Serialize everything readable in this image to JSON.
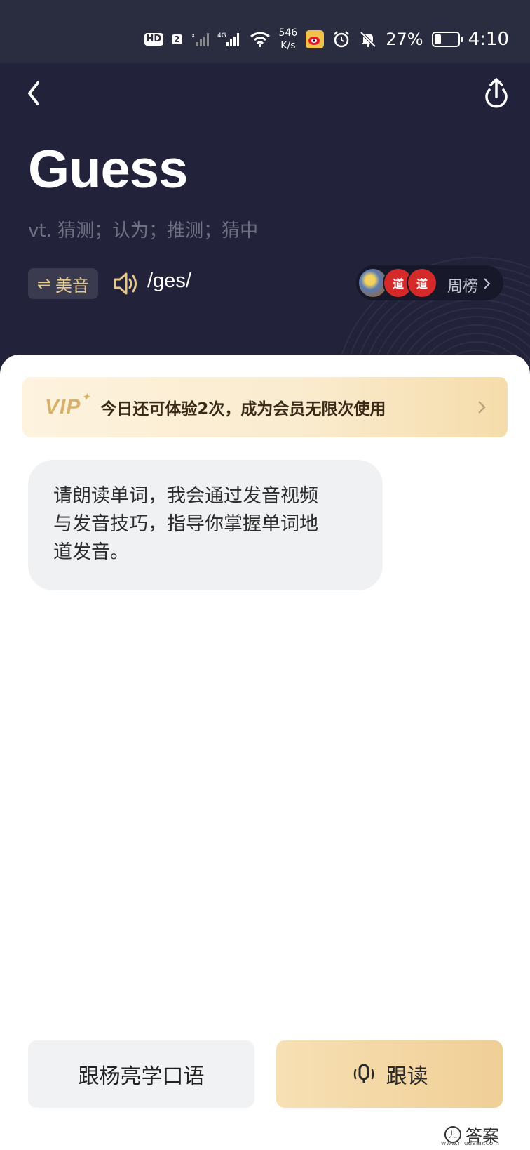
{
  "status_bar": {
    "hd": "HD",
    "sim": "2",
    "network": "4G",
    "speed_value": "546",
    "speed_unit": "K/s",
    "battery_percent": "27%",
    "time": "4:10",
    "icons": [
      "signal-x-icon",
      "signal-4g-icon",
      "wifi-icon",
      "weibo-icon",
      "alarm-icon",
      "mute-bell-icon",
      "battery-icon"
    ]
  },
  "header": {
    "back_icon": "chevron-left-icon",
    "share_icon": "share-icon"
  },
  "word": {
    "title": "Guess",
    "meaning": "vt. 猜测；认为；推测；猜中",
    "accent_label": "美音",
    "accent_icon": "swap-icon",
    "phonetic": "/ges/",
    "speaker_icon": "speaker-icon"
  },
  "ranking": {
    "avatar_texts": [
      "",
      "道",
      "道"
    ],
    "label": "周榜"
  },
  "vip_banner": {
    "logo": "VIP",
    "text": "今日还可体验2次，成为会员无限次使用"
  },
  "bubble": {
    "text_lines": [
      "请朗读单词，我会通过发音视频",
      "与发音技巧，指导你掌握单词地",
      "道发音。"
    ]
  },
  "buttons": {
    "left_label": "跟杨亮学口语",
    "right_label": "跟读",
    "right_icon": "microphone-icon"
  },
  "watermark": {
    "logo_char": "ㄦ",
    "text": "答案",
    "url": "www.mudaan.com"
  },
  "colors": {
    "header_bg": "#22233a",
    "status_bg": "#2a2c3f",
    "accent_gold": "#e6c88f",
    "vip_gold": "#d7b06a",
    "bubble_bg": "#f0f1f3"
  }
}
